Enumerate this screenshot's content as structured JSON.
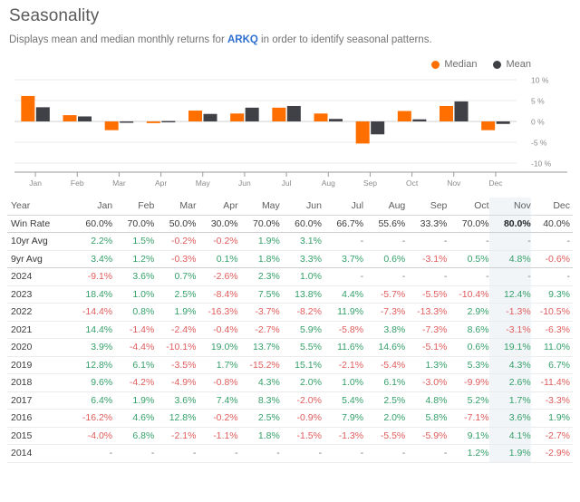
{
  "header": {
    "title": "Seasonality",
    "subtitle_before": "Displays mean and median monthly returns for ",
    "ticker": "ARKQ",
    "subtitle_after": " in order to identify seasonal patterns."
  },
  "legend": {
    "items": [
      {
        "label": "Median",
        "color": "#ff6f00",
        "icon": "circle-dot-icon"
      },
      {
        "label": "Mean",
        "color": "#3f4146",
        "icon": "circle-dot-icon"
      }
    ]
  },
  "colors": {
    "median": "#ff6f00",
    "mean": "#3f4146",
    "positive": "#35a06a",
    "negative": "#e05c5c",
    "link": "#2f6fd0",
    "highlight_column": "#f2f5f8"
  },
  "chart_data": {
    "type": "bar",
    "title": "Seasonality",
    "xlabel": "",
    "ylabel": "",
    "ylim": [
      -10,
      10
    ],
    "yticks": [
      10,
      5,
      0,
      -5,
      -10
    ],
    "ytick_labels": [
      "10 %",
      "5 %",
      "0 %",
      "-5 %",
      "-10 %"
    ],
    "grid": true,
    "legend_position": "top-right",
    "categories": [
      "Jan",
      "Feb",
      "Mar",
      "Apr",
      "May",
      "Jun",
      "Jul",
      "Aug",
      "Sep",
      "Oct",
      "Nov",
      "Dec"
    ],
    "series": [
      {
        "name": "Median",
        "color": "#ff6f00",
        "values": [
          6.1,
          1.5,
          -2.1,
          -0.4,
          2.6,
          1.9,
          3.3,
          1.9,
          -5.3,
          2.5,
          3.7,
          -2.1
        ]
      },
      {
        "name": "Mean",
        "color": "#3f4146",
        "values": [
          3.4,
          1.2,
          -0.3,
          0.1,
          1.8,
          3.3,
          3.7,
          0.6,
          -3.1,
          0.5,
          4.8,
          -0.6
        ]
      }
    ]
  },
  "table": {
    "columns": [
      "Year",
      "Jan",
      "Feb",
      "Mar",
      "Apr",
      "May",
      "Jun",
      "Jul",
      "Aug",
      "Sep",
      "Oct",
      "Nov",
      "Dec"
    ],
    "highlight_column_index": 11,
    "rows": [
      {
        "label": "Win Rate",
        "kind": "winrate",
        "values": [
          "60.0%",
          "70.0%",
          "50.0%",
          "30.0%",
          "70.0%",
          "60.0%",
          "66.7%",
          "55.6%",
          "33.3%",
          "70.0%",
          "80.0%",
          "40.0%"
        ]
      },
      {
        "label": "10yr Avg",
        "kind": "avg",
        "values": [
          "2.2%",
          "1.5%",
          "-0.2%",
          "-0.2%",
          "1.9%",
          "3.1%",
          "-",
          "-",
          "-",
          "-",
          "-",
          "-"
        ]
      },
      {
        "label": "9yr Avg",
        "kind": "avg",
        "values": [
          "3.4%",
          "1.2%",
          "-0.3%",
          "0.1%",
          "1.8%",
          "3.3%",
          "3.7%",
          "0.6%",
          "-3.1%",
          "0.5%",
          "4.8%",
          "-0.6%"
        ]
      },
      {
        "label": "2024",
        "kind": "year",
        "values": [
          "-9.1%",
          "3.6%",
          "0.7%",
          "-2.6%",
          "2.3%",
          "1.0%",
          "-",
          "-",
          "-",
          "-",
          "-",
          "-"
        ]
      },
      {
        "label": "2023",
        "kind": "year",
        "values": [
          "18.4%",
          "1.0%",
          "2.5%",
          "-8.4%",
          "7.5%",
          "13.8%",
          "4.4%",
          "-5.7%",
          "-5.5%",
          "-10.4%",
          "12.4%",
          "9.3%"
        ]
      },
      {
        "label": "2022",
        "kind": "year",
        "values": [
          "-14.4%",
          "0.8%",
          "1.9%",
          "-16.3%",
          "-3.7%",
          "-8.2%",
          "11.9%",
          "-7.3%",
          "-13.3%",
          "2.9%",
          "-1.3%",
          "-10.5%"
        ]
      },
      {
        "label": "2021",
        "kind": "year",
        "values": [
          "14.4%",
          "-1.4%",
          "-2.4%",
          "-0.4%",
          "-2.7%",
          "5.9%",
          "-5.8%",
          "3.8%",
          "-7.3%",
          "8.6%",
          "-3.1%",
          "-6.3%"
        ]
      },
      {
        "label": "2020",
        "kind": "year",
        "values": [
          "3.9%",
          "-4.4%",
          "-10.1%",
          "19.0%",
          "13.7%",
          "5.5%",
          "11.6%",
          "14.6%",
          "-5.1%",
          "0.6%",
          "19.1%",
          "11.0%"
        ]
      },
      {
        "label": "2019",
        "kind": "year",
        "values": [
          "12.8%",
          "6.1%",
          "-3.5%",
          "1.7%",
          "-15.2%",
          "15.1%",
          "-2.1%",
          "-5.4%",
          "1.3%",
          "5.3%",
          "4.3%",
          "6.7%"
        ]
      },
      {
        "label": "2018",
        "kind": "year",
        "values": [
          "9.6%",
          "-4.2%",
          "-4.9%",
          "-0.8%",
          "4.3%",
          "2.0%",
          "1.0%",
          "6.1%",
          "-3.0%",
          "-9.9%",
          "2.6%",
          "-11.4%"
        ]
      },
      {
        "label": "2017",
        "kind": "year",
        "values": [
          "6.4%",
          "1.9%",
          "3.6%",
          "7.4%",
          "8.3%",
          "-2.0%",
          "5.4%",
          "2.5%",
          "4.8%",
          "5.2%",
          "1.7%",
          "-3.3%"
        ]
      },
      {
        "label": "2016",
        "kind": "year",
        "values": [
          "-16.2%",
          "4.6%",
          "12.8%",
          "-0.2%",
          "2.5%",
          "-0.9%",
          "7.9%",
          "2.0%",
          "5.8%",
          "-7.1%",
          "3.6%",
          "1.9%"
        ]
      },
      {
        "label": "2015",
        "kind": "year",
        "values": [
          "-4.0%",
          "6.8%",
          "-2.1%",
          "-1.1%",
          "1.8%",
          "-1.5%",
          "-1.3%",
          "-5.5%",
          "-5.9%",
          "9.1%",
          "4.1%",
          "-2.7%"
        ]
      },
      {
        "label": "2014",
        "kind": "year",
        "values": [
          "-",
          "-",
          "-",
          "-",
          "-",
          "-",
          "-",
          "-",
          "-",
          "1.2%",
          "1.9%",
          "-2.9%"
        ]
      }
    ]
  }
}
